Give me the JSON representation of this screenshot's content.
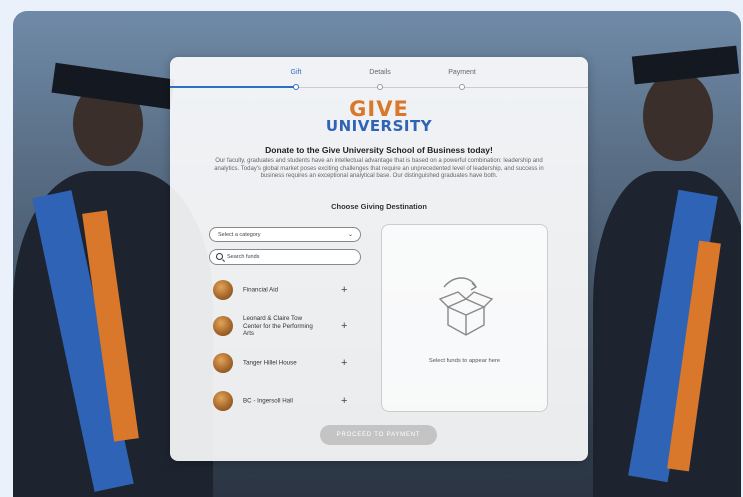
{
  "steps": [
    {
      "label": "Gift",
      "active": true
    },
    {
      "label": "Details",
      "active": false
    },
    {
      "label": "Payment",
      "active": false
    }
  ],
  "logo": {
    "line1": "GIVE",
    "line2": "UNIVERSITY"
  },
  "heading": "Donate to the Give University School of Business today!",
  "description": "Our faculty, graduates and students have an intellectual advantage that is based on a powerful combination: leadership and analytics. Today's global market poses exciting challenges that require an unprecedented level of leadership, and success in business requires an exceptional analytical base. Our distinguished graduates have both.",
  "choose_label": "Choose Giving Destination",
  "category_select": {
    "value": "Select a category"
  },
  "search": {
    "placeholder": "Search funds"
  },
  "funds": [
    {
      "name": "Financial Aid"
    },
    {
      "name": "Leonard & Claire Tow Center for the Performing Arts"
    },
    {
      "name": "Tanger Hillel House"
    },
    {
      "name": "BC - Ingersoll Hall"
    }
  ],
  "dropzone": {
    "hint": "Select funds to appear here",
    "icon": "open-box-icon"
  },
  "proceed_button": "PROCEED TO PAYMENT",
  "colors": {
    "accent": "#2e6fbf",
    "brand_orange": "#d9772a",
    "brand_blue": "#2e63b5",
    "button_disabled": "#c4c4c4"
  }
}
